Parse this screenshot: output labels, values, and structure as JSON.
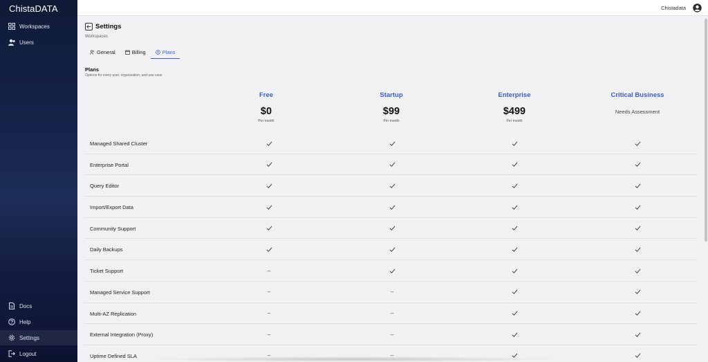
{
  "app": {
    "brand": "ChistaDATA"
  },
  "sidebar": {
    "top_items": [
      {
        "label": "Workspaces",
        "icon": "grid-icon"
      },
      {
        "label": "Users",
        "icon": "users-icon"
      }
    ],
    "bottom_items": [
      {
        "label": "Docs",
        "icon": "document-icon"
      },
      {
        "label": "Help",
        "icon": "help-icon"
      },
      {
        "label": "Settings",
        "icon": "gear-icon",
        "active": true
      },
      {
        "label": "Logout",
        "icon": "logout-icon"
      }
    ]
  },
  "topbar": {
    "org_name": "Chistadata",
    "avatar_icon": "account-circle-icon"
  },
  "header": {
    "title": "Settings",
    "breadcrumb": "Workspaces"
  },
  "tabs": [
    {
      "label": "General",
      "icon": "people-icon",
      "active": false
    },
    {
      "label": "Billing",
      "icon": "calendar-icon",
      "active": false
    },
    {
      "label": "Plans",
      "icon": "plan-icon",
      "active": true
    }
  ],
  "plans_section": {
    "title": "Plans",
    "subtitle": "Options for every user, organization, and use case"
  },
  "plans": [
    {
      "name": "Free",
      "price": "$0",
      "period": "Per month",
      "note": ""
    },
    {
      "name": "Startup",
      "price": "$99",
      "period": "Per month",
      "note": ""
    },
    {
      "name": "Enterprise",
      "price": "$499",
      "period": "Per month",
      "note": ""
    },
    {
      "name": "Critical Business",
      "price": "",
      "period": "",
      "note": "Needs Assessment"
    }
  ],
  "features": [
    {
      "label": "Managed Shared Cluster",
      "included": [
        true,
        true,
        true,
        true
      ]
    },
    {
      "label": "Enterprise Portal",
      "included": [
        true,
        true,
        true,
        true
      ]
    },
    {
      "label": "Query Editor",
      "included": [
        true,
        true,
        true,
        true
      ]
    },
    {
      "label": "Import/Export Data",
      "included": [
        true,
        true,
        true,
        true
      ]
    },
    {
      "label": "Community Support",
      "included": [
        true,
        true,
        true,
        true
      ]
    },
    {
      "label": "Daily Backups",
      "included": [
        true,
        true,
        true,
        true
      ]
    },
    {
      "label": "Ticket Support",
      "included": [
        false,
        true,
        true,
        true
      ]
    },
    {
      "label": "Managed Service Support",
      "included": [
        false,
        false,
        true,
        true
      ]
    },
    {
      "label": "Multi-AZ Replication",
      "included": [
        false,
        false,
        true,
        true
      ]
    },
    {
      "label": "External Integration (Proxy)",
      "included": [
        false,
        false,
        true,
        true
      ]
    },
    {
      "label": "Uptime Defined SLA",
      "included": [
        false,
        false,
        true,
        true
      ]
    }
  ],
  "symbols": {
    "excluded": "–"
  },
  "colors": {
    "accent": "#3a5bd9",
    "sidebar": "#15244a"
  }
}
